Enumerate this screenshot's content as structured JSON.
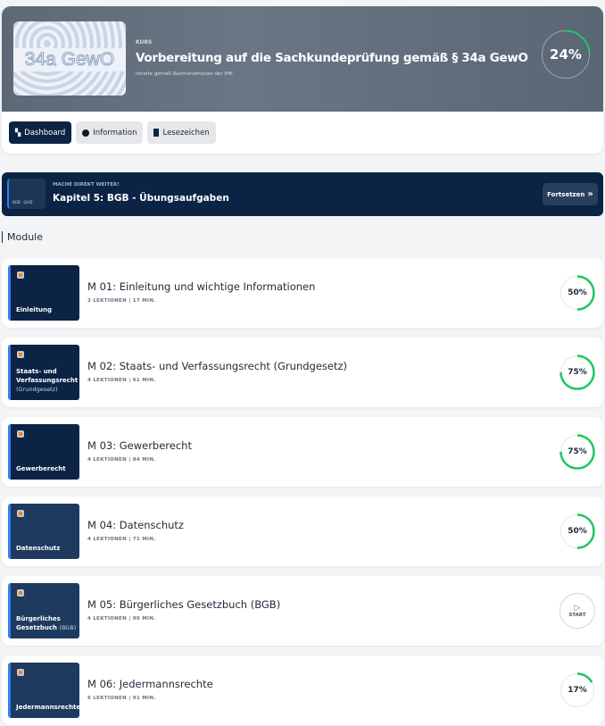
{
  "course": {
    "kicker": "KURS",
    "title": "Vorbereitung auf die Sachkundeprüfung gemäß § 34a GewO",
    "subtitle": "Inhalte gemäß Rahmenlehrplan der IHK",
    "thumb_text": "34a GewO",
    "progress": 24,
    "progress_label": "24%"
  },
  "tabs": [
    {
      "label": "Dashboard",
      "icon": "dashboard-icon",
      "active": true
    },
    {
      "label": "Information",
      "icon": "info-icon"
    },
    {
      "label": "Lesezeichen",
      "icon": "bookmark-icon"
    }
  ],
  "continue": {
    "kicker": "MACHE DIREKT WEITER!",
    "title": "Kapitel 5: BGB - Übungsaufgaben",
    "thumb_text": "BGB - QUIZ",
    "button": "Fortsetzen"
  },
  "section_title": "Module",
  "modules": [
    {
      "title": "M 01: Einleitung und wichtige Informationen",
      "meta": "2 LEKTIONEN | 17 MIN.",
      "thumb": "Einleitung",
      "thumb_sub": "",
      "progress": 50,
      "label": "50%"
    },
    {
      "title": "M 02: Staats- und Verfassungsrecht (Grundgesetz)",
      "meta": "4 LEKTIONEN | 61 MIN.",
      "thumb": "Staats- und Verfassungsrecht",
      "thumb_sub": "(Grundgesetz)",
      "progress": 75,
      "label": "75%"
    },
    {
      "title": "M 03: Gewerberecht",
      "meta": "4 LEKTIONEN | 84 MIN.",
      "thumb": "Gewerberecht",
      "thumb_sub": "",
      "progress": 75,
      "label": "75%"
    },
    {
      "title": "M 04: Datenschutz",
      "meta": "4 LEKTIONEN | 71 MIN.",
      "thumb": "Datenschutz",
      "thumb_sub": "",
      "progress": 50,
      "label": "50%"
    },
    {
      "title": "M 05: Bürgerliches Gesetzbuch (BGB)",
      "meta": "4 LEKTIONEN | 90 MIN.",
      "thumb": "Bürgerliches Gesetzbuch",
      "thumb_sub": "(BGB)",
      "progress": null,
      "label": "START"
    },
    {
      "title": "M 06: Jedermannsrechte",
      "meta": "6 LEKTIONEN | 91 MIN.",
      "thumb": "Jedermannsrechte",
      "thumb_sub": "",
      "progress": 17,
      "label": "17%"
    }
  ],
  "colors": {
    "navy": "#0b2345",
    "green": "#22c55e",
    "accent": "#2f80ed"
  }
}
